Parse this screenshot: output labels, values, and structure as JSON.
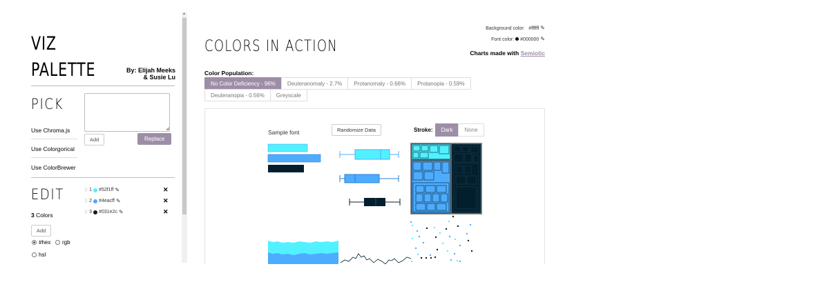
{
  "brand": {
    "line1": "VIZ",
    "line2": "PALETTE"
  },
  "byline": {
    "line1": "By: Elijah Meeks",
    "line2": "& Susie Lu"
  },
  "pick": {
    "title": "PICK",
    "links": [
      "Use Chroma.js",
      "Use Colorgorical",
      "Use ColorBrewer"
    ],
    "textarea_value": "",
    "add_label": "Add",
    "replace_label": "Replace"
  },
  "edit": {
    "title": "EDIT",
    "count": "3",
    "count_label": "Colors",
    "add_label": "Add",
    "formats": [
      "#hex",
      "rgb",
      "hsl"
    ],
    "selected_format": "#hex",
    "colors": [
      {
        "index": "1",
        "hex": "#52f1ff"
      },
      {
        "index": "2",
        "hex": "#4eacff"
      },
      {
        "index": "3",
        "hex": "#031e2c"
      }
    ]
  },
  "main": {
    "title": "COLORS IN ACTION",
    "background_label": "Background color:",
    "background_value": "#ffffff",
    "font_label": "Font color:",
    "font_value": "#000000",
    "charts_made_with": "Charts made with",
    "semiotic": "Semiotic",
    "color_population_label": "Color Population:",
    "tabs": [
      "No Color Deficiency - 96%",
      "Deuteranomaly - 2.7%",
      "Protanomaly - 0.66%",
      "Protanopia - 0.59%",
      "Deuteranopia - 0.56%",
      "Greyscale"
    ],
    "active_tab": 0,
    "sample_font": "Sample font",
    "randomize_label": "Randomize Data",
    "stroke_label": "Stroke:",
    "stroke_options": [
      "Dark",
      "None"
    ],
    "stroke_active": "Dark"
  },
  "colors": {
    "accent": "#9d8ea7",
    "c1": "#52f1ff",
    "c2": "#4eacff",
    "c3": "#031e2c"
  }
}
